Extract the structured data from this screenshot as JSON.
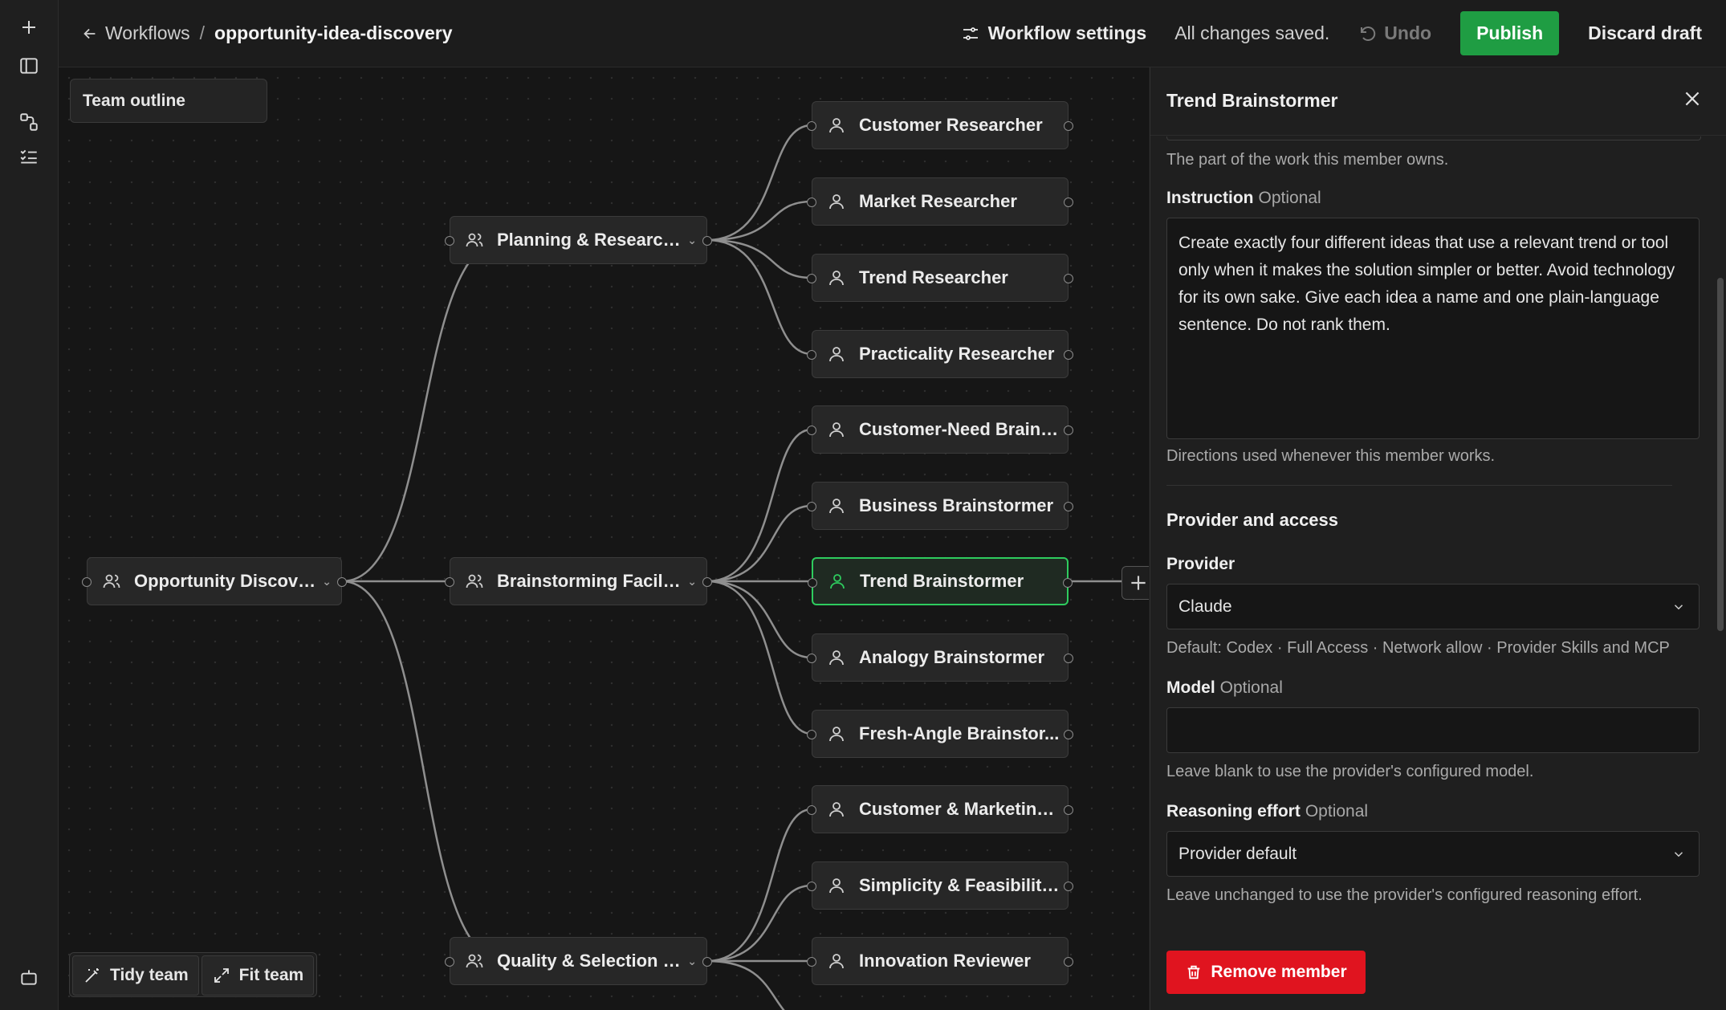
{
  "breadcrumb": {
    "back": "Workflows",
    "separator": "/",
    "current": "opportunity-idea-discovery"
  },
  "toolbar": {
    "workflow_settings": "Workflow settings",
    "status": "All changes saved.",
    "undo": "Undo",
    "publish": "Publish",
    "discard": "Discard draft"
  },
  "canvas": {
    "team_outline": "Team outline",
    "nodes": {
      "root": "Opportunity Discovery ...",
      "planning": "Planning & Research Di...",
      "brainstorm": "Brainstorming Facilitator",
      "quality": "Quality & Selection Chair",
      "customer_researcher": "Customer Researcher",
      "market_researcher": "Market Researcher",
      "trend_researcher": "Trend Researcher",
      "practicality_researcher": "Practicality Researcher",
      "customer_need": "Customer-Need Brainst...",
      "business_brainstormer": "Business Brainstormer",
      "trend_brainstormer": "Trend Brainstormer",
      "analogy_brainstormer": "Analogy Brainstormer",
      "fresh_angle": "Fresh-Angle Brainstor...",
      "customer_marketing": "Customer & Marketing ...",
      "simplicity": "Simplicity & Feasibility ...",
      "innovation": "Innovation Reviewer"
    },
    "tidy": "Tidy team",
    "fit": "Fit team"
  },
  "panel": {
    "title": "Trend Brainstormer",
    "role_hint": "The part of the work this member owns.",
    "instruction_label": "Instruction",
    "optional": "Optional",
    "instruction_text": "Create exactly four different ideas that use a relevant trend or tool only when it makes the solution simpler or better. Avoid technology for its own sake. Give each idea a name and one plain-language sentence. Do not rank them.",
    "instruction_hint": "Directions used whenever this member works.",
    "section_title": "Provider and access",
    "provider_label": "Provider",
    "provider_value": "Claude",
    "provider_hint": "Default: Codex · Full Access · Network allow · Provider Skills and MCP",
    "model_label": "Model",
    "model_value": "",
    "model_hint": "Leave blank to use the provider's configured model.",
    "reasoning_label": "Reasoning effort",
    "reasoning_value": "Provider default",
    "reasoning_hint": "Leave unchanged to use the provider's configured reasoning effort.",
    "remove": "Remove member"
  },
  "colors": {
    "accent_green": "#1f9d43",
    "selected_border": "#2ecc5e",
    "danger": "#e0141f"
  }
}
